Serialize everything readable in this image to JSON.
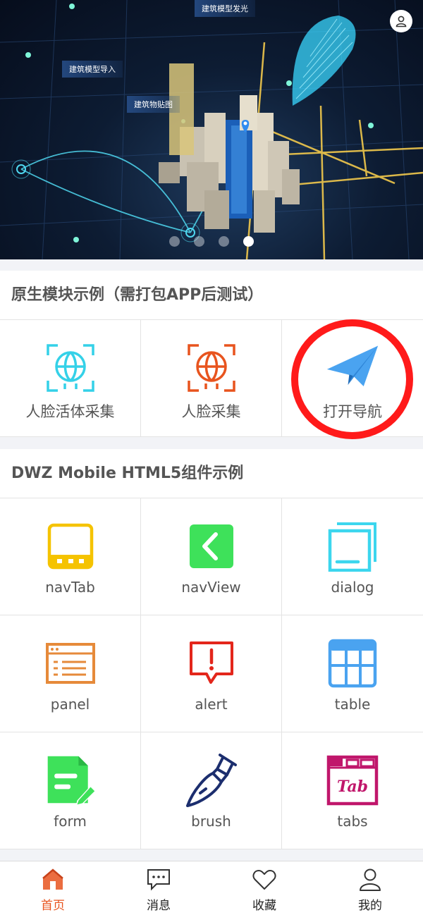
{
  "banner": {
    "labels": [
      "建筑模型发光",
      "建筑模型导入",
      "建筑物贴图"
    ],
    "slide_count": 4,
    "active_slide": 4
  },
  "native_section": {
    "title": "原生模块示例（需打包APP后测试）",
    "items": [
      {
        "label": "人脸活体采集",
        "icon": "face-scan-cyan-icon",
        "color": "#34d1e8"
      },
      {
        "label": "人脸采集",
        "icon": "face-scan-orange-icon",
        "color": "#e8541e"
      },
      {
        "label": "打开导航",
        "icon": "paper-plane-icon",
        "color": "#4aa3f0"
      }
    ]
  },
  "html5_section": {
    "title": "DWZ Mobile HTML5组件示例",
    "items": [
      {
        "label": "navTab",
        "icon": "navtab-icon",
        "color": "#f5c300"
      },
      {
        "label": "navView",
        "icon": "navview-back-icon",
        "color": "#3ee15a"
      },
      {
        "label": "dialog",
        "icon": "dialog-icon",
        "color": "#3cd6ee"
      },
      {
        "label": "panel",
        "icon": "panel-icon",
        "color": "#e68a3a"
      },
      {
        "label": "alert",
        "icon": "alert-icon",
        "color": "#e3261b"
      },
      {
        "label": "table",
        "icon": "table-icon",
        "color": "#4aa3f0"
      },
      {
        "label": "form",
        "icon": "form-icon",
        "color": "#3ee15a"
      },
      {
        "label": "brush",
        "icon": "brush-icon",
        "color": "#1c2e6e"
      },
      {
        "label": "tabs",
        "icon": "tabs-icon",
        "color": "#c0166b"
      }
    ]
  },
  "tabbar": {
    "items": [
      {
        "label": "首页",
        "icon": "home-icon",
        "active": true
      },
      {
        "label": "消息",
        "icon": "message-icon",
        "active": false
      },
      {
        "label": "收藏",
        "icon": "heart-icon",
        "active": false
      },
      {
        "label": "我的",
        "icon": "user-icon",
        "active": false
      }
    ],
    "active_color": "#e8541e"
  }
}
